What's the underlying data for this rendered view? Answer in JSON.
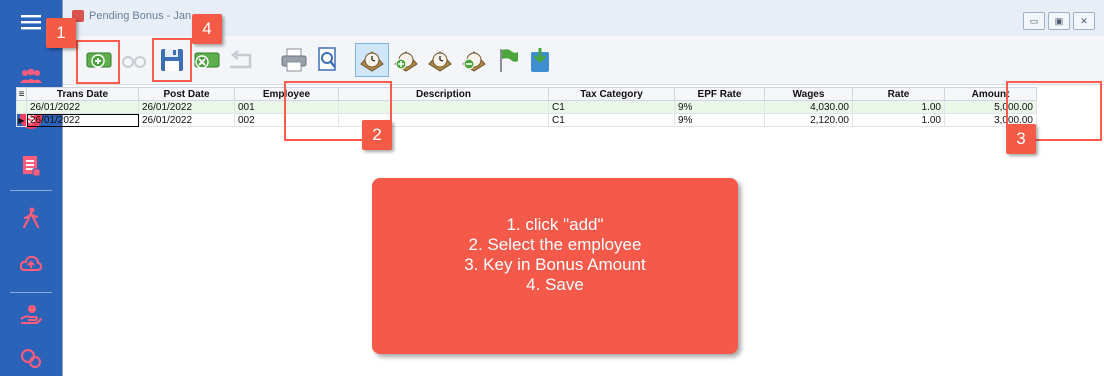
{
  "window": {
    "title": "Pending Bonus - Jan",
    "controls": {
      "minimize": "▭",
      "maximize": "▣",
      "close": "✕"
    }
  },
  "toolbar": {
    "buttons": [
      {
        "name": "add-button",
        "icon": "money-add-icon",
        "enabled": true
      },
      {
        "name": "view-button",
        "icon": "glasses-icon",
        "enabled": false
      },
      {
        "name": "save-button",
        "icon": "floppy-disk-icon",
        "enabled": true
      },
      {
        "name": "delete-button",
        "icon": "money-delete-icon",
        "enabled": true
      },
      {
        "name": "undo-button",
        "icon": "undo-icon",
        "enabled": false
      },
      {
        "name": "print-button",
        "icon": "printer-icon",
        "enabled": true
      },
      {
        "name": "preview-button",
        "icon": "print-preview-icon",
        "enabled": true
      },
      {
        "name": "timer-button",
        "icon": "clock-icon",
        "enabled": true
      },
      {
        "name": "timer-add-button",
        "icon": "clock-add-icon",
        "enabled": true
      },
      {
        "name": "timer-edit-button",
        "icon": "clock-edit-icon",
        "enabled": true
      },
      {
        "name": "timer-remove-button",
        "icon": "clock-remove-icon",
        "enabled": true
      },
      {
        "name": "flag-button",
        "icon": "green-flag-icon",
        "enabled": true
      },
      {
        "name": "export-button",
        "icon": "export-download-icon",
        "enabled": true
      }
    ]
  },
  "grid": {
    "columns": [
      "Trans Date",
      "Post Date",
      "Employee",
      "Description",
      "Tax Category",
      "EPF Rate",
      "Wages",
      "Rate",
      "Amount"
    ],
    "rows": [
      {
        "trans_date": "26/01/2022",
        "post_date": "26/01/2022",
        "employee": "001",
        "description": "",
        "tax_category": "C1",
        "epf_rate": "9%",
        "wages": "4,030.00",
        "rate": "1.00",
        "amount": "5,000.00"
      },
      {
        "trans_date": "26/01/2022",
        "post_date": "26/01/2022",
        "employee": "002",
        "description": "",
        "tax_category": "C1",
        "epf_rate": "9%",
        "wages": "2,120.00",
        "rate": "1.00",
        "amount": "3,000.00"
      }
    ]
  },
  "markers": [
    "1",
    "2",
    "3",
    "4"
  ],
  "instructions": [
    "1. click \"add\"",
    "2. Select the employee",
    "3. Key in Bonus Amount",
    "4. Save"
  ],
  "colors": {
    "sidebar": "#2a63b8",
    "accent": "#f4594a",
    "highlight_border": "#ff5a4e",
    "selected_row": "#eaf6e8"
  },
  "sidebar": {
    "icons": [
      "hamburger-menu-icon",
      "employees-icon",
      "payroll-dollar-icon",
      "report-icon",
      "walking-person-icon",
      "cloud-upload-icon",
      "hand-coin-icon",
      "settings-people-icon"
    ]
  }
}
